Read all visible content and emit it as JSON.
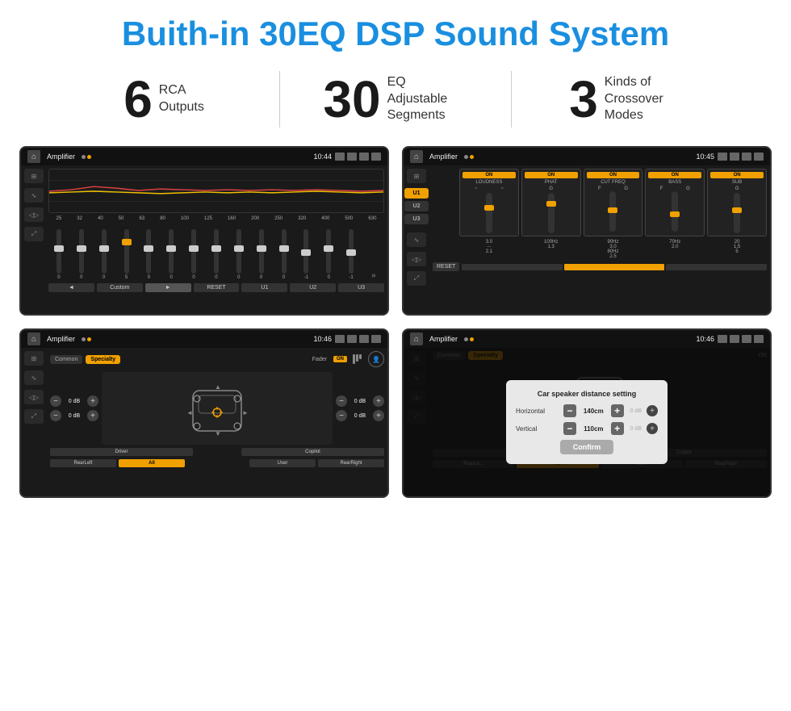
{
  "page": {
    "title": "Buith-in 30EQ DSP Sound System"
  },
  "stats": [
    {
      "number": "6",
      "text": "RCA\nOutputs"
    },
    {
      "number": "30",
      "text": "EQ Adjustable\nSegments"
    },
    {
      "number": "3",
      "text": "Kinds of\nCrossover Modes"
    }
  ],
  "screens": [
    {
      "id": "eq-screen",
      "statusBar": {
        "title": "Amplifier",
        "time": "10:44"
      },
      "type": "eq"
    },
    {
      "id": "crossover-screen",
      "statusBar": {
        "title": "Amplifier",
        "time": "10:45"
      },
      "type": "crossover"
    },
    {
      "id": "fader-screen",
      "statusBar": {
        "title": "Amplifier",
        "time": "10:46"
      },
      "type": "fader"
    },
    {
      "id": "distance-screen",
      "statusBar": {
        "title": "Amplifier",
        "time": "10:46"
      },
      "type": "distance"
    }
  ],
  "eq": {
    "freqLabels": [
      "25",
      "32",
      "40",
      "50",
      "63",
      "80",
      "100",
      "125",
      "160",
      "200",
      "250",
      "320",
      "400",
      "500",
      "630"
    ],
    "values": [
      "0",
      "0",
      "0",
      "5",
      "0",
      "0",
      "0",
      "0",
      "0",
      "0",
      "0",
      "-1",
      "0",
      "-1"
    ],
    "presets": [
      "Custom",
      "RESET",
      "U1",
      "U2",
      "U3"
    ]
  },
  "crossover": {
    "presets": [
      "U1",
      "U2",
      "U3"
    ],
    "channels": [
      "LOUDNESS",
      "PHAT",
      "CUT FREQ",
      "BASS",
      "SUB"
    ],
    "resetLabel": "RESET"
  },
  "fader": {
    "tabs": [
      "Common",
      "Specialty"
    ],
    "faderLabel": "Fader",
    "onLabel": "ON",
    "dbValues": [
      "0 dB",
      "0 dB",
      "0 dB",
      "0 dB"
    ],
    "positions": [
      "Driver",
      "Copilot",
      "RearLeft",
      "RearRight"
    ],
    "allLabel": "All",
    "userLabel": "User"
  },
  "distance": {
    "title": "Car speaker distance setting",
    "horizontal": {
      "label": "Horizontal",
      "value": "140cm"
    },
    "vertical": {
      "label": "Vertical",
      "value": "110cm"
    },
    "confirmLabel": "Confirm"
  }
}
